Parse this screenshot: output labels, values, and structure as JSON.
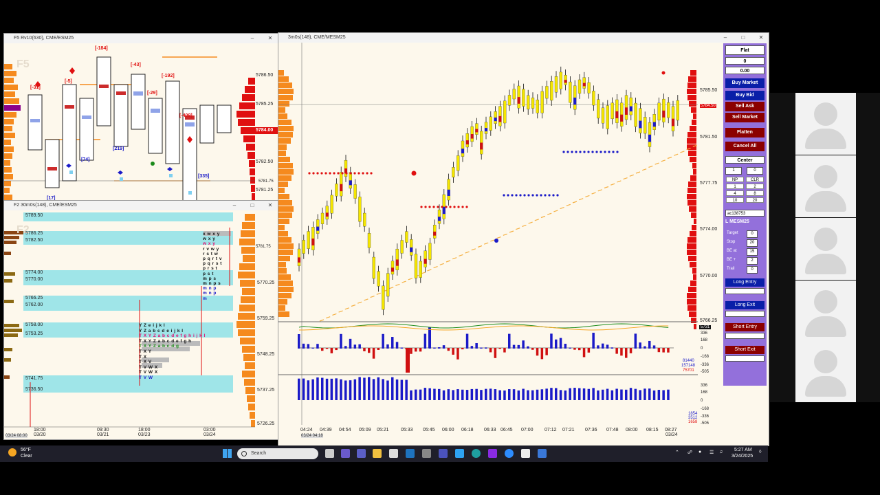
{
  "colors": {
    "chart_bg": "#fdf8ec",
    "value_area": "#9fe5e8",
    "order_panel": "#9370db",
    "buy_blue": "#0a1fa8",
    "sell_red": "#8b0000",
    "bar_yellow": "#f5e600",
    "profile_orange": "#f58a1e",
    "profile_red": "#e01010"
  },
  "left_top_window": {
    "title": "F5 Rv10(630), CME/ESM25",
    "watermark": "F5",
    "deltas": [
      "[-31]",
      "[-5]",
      "[-184]",
      "[-43]",
      "[-29]",
      "[-192]",
      "[-409]",
      "[17]",
      "[74]",
      "[219]",
      "[335]"
    ],
    "price_labels": [
      "5786.50",
      "5785.25",
      "5784.00",
      "5782.50",
      "5781.75",
      "5781.25"
    ],
    "current_price": "5784.00",
    "small_marker": "5781.75"
  },
  "left_bottom_window": {
    "title": "F2 30m0s(148), CME/ESM25",
    "watermark": "F2",
    "value_levels": [
      "5789.50",
      "5786.25",
      "5782.50",
      "5774.00",
      "5770.00",
      "5766.25",
      "5762.00",
      "5758.00",
      "5753.25",
      "5741.75",
      "5736.50"
    ],
    "price_labels": [
      "5781.75",
      "5770.25",
      "5759.25",
      "5748.25",
      "5737.25",
      "5726.25"
    ],
    "tpo_rows": [
      "x w x y",
      "w x y",
      "w x y",
      "r v w y",
      "r s t w",
      "p q r t v",
      "p q r s t",
      "p r s t",
      "p s t",
      "m p s",
      "m n p s",
      "m n p",
      "m n p",
      "m",
      "Y Z e i j k l",
      "Y Z a b c d e i j k l",
      "T X Y Z a b c d e f g h i j k l",
      "T X Y Z a b c d e f g h",
      "T X Y Z a b c d g",
      "T X Y",
      "T X",
      "T X V",
      "T V W X",
      "T V W X",
      "T V W"
    ],
    "time_labels": [
      "18:00\n03/20",
      "09:30\n03/21",
      "18:00\n03/23",
      "03:00\n03/24"
    ],
    "date_box": "03/24 08:00"
  },
  "main_window": {
    "title": "3m0s(148), CME/MESM25",
    "price_labels": [
      "5785.50",
      "5781.50",
      "5777.75",
      "5774.00",
      "5770.00",
      "5766.25"
    ],
    "current_price": "5784.50",
    "time_labels": [
      "04:24",
      "04:39",
      "04:54",
      "05:09",
      "05:21",
      "05:33",
      "05:45",
      "06:00",
      "06:18",
      "06:33",
      "06:45",
      "07:00",
      "07:12",
      "07:21",
      "07:36",
      "07:48",
      "08:00",
      "08:15",
      "08:27"
    ],
    "date_box": "03/24 04:18",
    "last_date": "03/24",
    "delta_axis": [
      "5731",
      "336",
      "168",
      "0",
      "-168",
      "-336",
      "-505"
    ],
    "delta_values": [
      "81440",
      "157148",
      "75701"
    ],
    "cum_axis": [
      "336",
      "168",
      "0",
      "-168",
      "-336",
      "-505"
    ],
    "cum_values": [
      "1854",
      "3512",
      "1658"
    ]
  },
  "order_panel": {
    "position": "Flat",
    "qty": "0",
    "pnl": "0.00",
    "buy_market": "Buy Market",
    "buy_bid": "Buy Bid",
    "sell_ask": "Sell Ask",
    "sell_market": "Sell Market",
    "flatten": "Flatten",
    "cancel_all": "Cancel All",
    "center": "Center",
    "qty_input": "1",
    "qty_input2": "0",
    "np": "NP",
    "clr": "CLR",
    "grid": [
      "1",
      "2",
      "4",
      "8",
      "10",
      "20"
    ],
    "account": "ac138753",
    "symbol": "L MESM25",
    "target_label": "Target",
    "target_val": "0",
    "stop_label": "Stop",
    "stop_val": "20",
    "beat_label": "BE at",
    "beat_val": "15",
    "beplus_label": "BE +",
    "beplus_val": "2",
    "trail_label": "Trail",
    "trail_val": "0",
    "long_entry": "Long Entry",
    "long_exit": "Long Exit",
    "short_entry": "Short Entry",
    "short_exit": "Short Exit"
  },
  "taskbar": {
    "weather_temp": "56°F",
    "weather_desc": "Clear",
    "search_placeholder": "Search",
    "time": "5:27 AM",
    "date": "3/24/2025"
  },
  "participant_avatars": 5
}
